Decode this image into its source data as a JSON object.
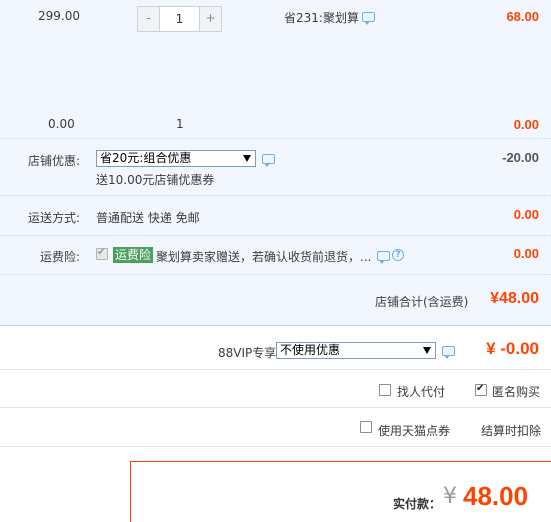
{
  "items": [
    {
      "unit_price": "299.00",
      "quantity": "1",
      "promotion": "省231:聚划算",
      "subtotal": "68.00"
    },
    {
      "unit_price": "0.00",
      "quantity": "1",
      "subtotal": "0.00"
    }
  ],
  "stepper": {
    "minus": "-",
    "plus": "+"
  },
  "shop_discount": {
    "label": "店铺优惠:",
    "selected": "省20元:组合优惠",
    "note": "送10.00元店铺优惠券",
    "amount": "-20.00"
  },
  "shipping": {
    "label": "运送方式:",
    "method": "普通配送 快递 免邮",
    "amount": "0.00"
  },
  "insurance": {
    "label": "运费险:",
    "tag": "运费险",
    "desc": "聚划算卖家赠送，若确认收货前退货，...",
    "amount": "0.00",
    "help": "?"
  },
  "shop_total": {
    "label": "店铺合计(含运费)",
    "amount": "¥48.00"
  },
  "vip": {
    "label": "88VIP专享",
    "selected": "不使用优惠",
    "amount": "¥ -0.00"
  },
  "options": {
    "agent_pay": "找人代付",
    "anonymous": "匿名购买",
    "tmall_points": "使用天猫点券",
    "points_note": "结算时扣除"
  },
  "payment": {
    "label": "实付款：",
    "currency": "¥",
    "amount": "48.00"
  },
  "colors": {
    "accent": "#ff4400",
    "panel_bg": "#f2f7ff",
    "tag_green": "#4c9f5a",
    "link_blue": "#6fb0e6"
  }
}
